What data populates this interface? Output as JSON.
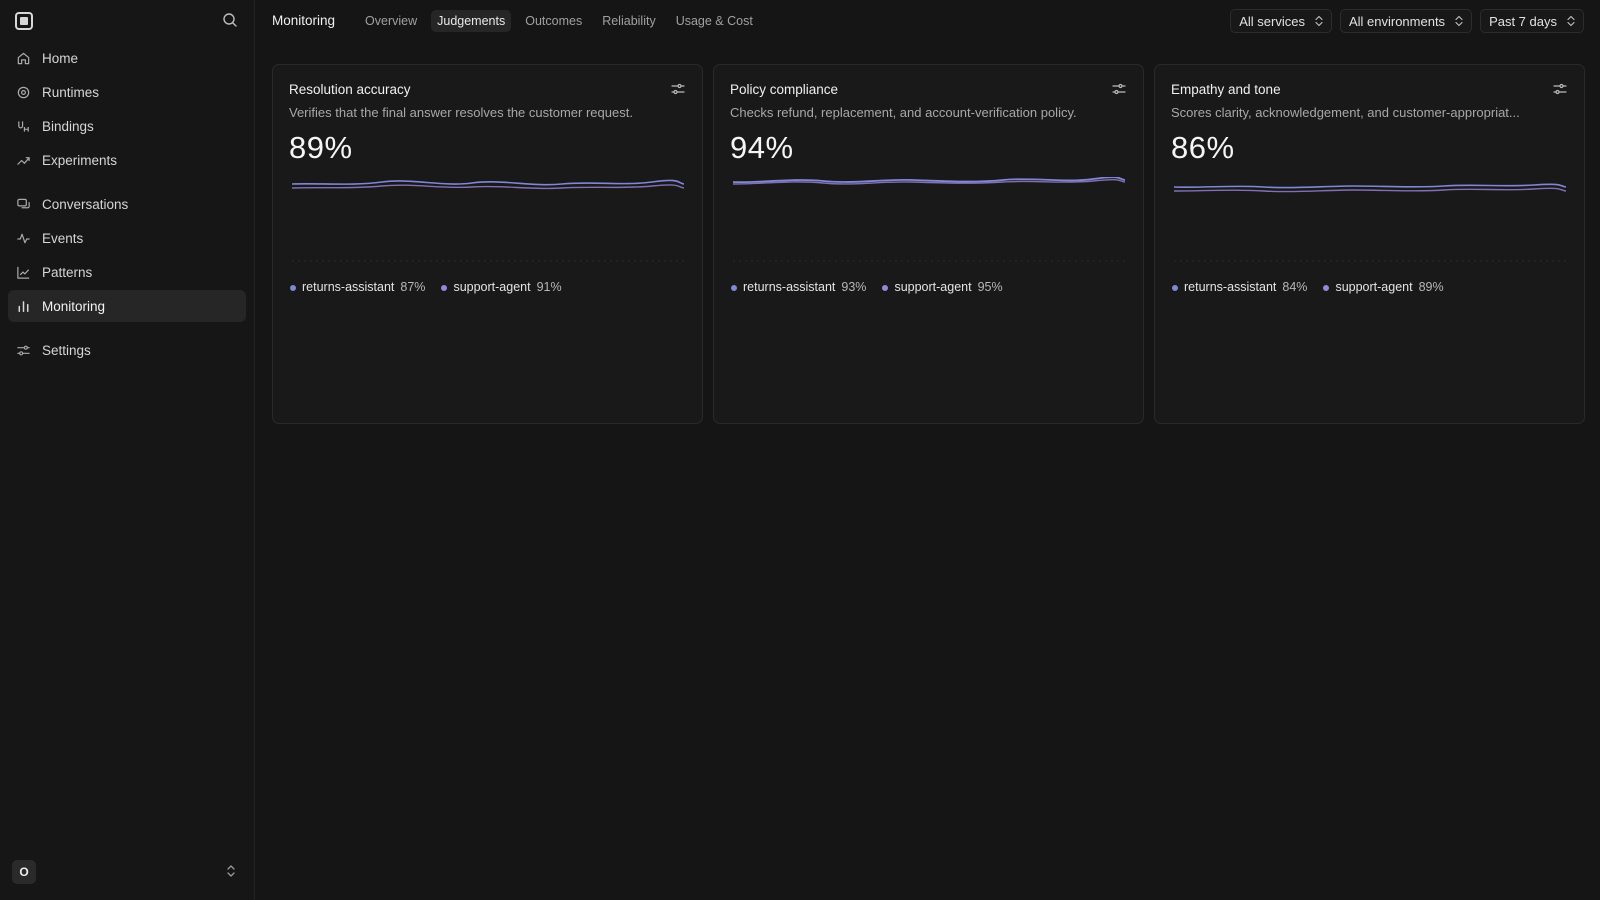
{
  "sidebar": {
    "items": [
      {
        "label": "Home",
        "icon": "home-icon"
      },
      {
        "label": "Runtimes",
        "icon": "runtime-icon"
      },
      {
        "label": "Bindings",
        "icon": "bindings-icon"
      },
      {
        "label": "Experiments",
        "icon": "experiments-icon"
      },
      {
        "label": "Conversations",
        "icon": "conversations-icon"
      },
      {
        "label": "Events",
        "icon": "events-icon"
      },
      {
        "label": "Patterns",
        "icon": "patterns-icon"
      },
      {
        "label": "Monitoring",
        "icon": "monitoring-icon",
        "active": true
      },
      {
        "label": "Settings",
        "icon": "settings-icon"
      }
    ],
    "workspace_initial": "O"
  },
  "topbar": {
    "title": "Monitoring",
    "tabs": [
      "Overview",
      "Judgements",
      "Outcomes",
      "Reliability",
      "Usage & Cost"
    ],
    "active_tab": "Judgements",
    "filters": [
      "All services",
      "All environments",
      "Past 7 days"
    ]
  },
  "colors": {
    "accent": "#7b7fd4",
    "series_returns": "#8087d6",
    "series_support": "#9a86d8"
  },
  "cards": [
    {
      "title": "Resolution accuracy",
      "description": "Verifies that the final answer resolves the customer request.",
      "value": "89%",
      "legend": [
        {
          "name": "returns-assistant",
          "value": "87%"
        },
        {
          "name": "support-agent",
          "value": "91%"
        }
      ]
    },
    {
      "title": "Policy compliance",
      "description": "Checks refund, replacement, and account-verification policy.",
      "value": "94%",
      "legend": [
        {
          "name": "returns-assistant",
          "value": "93%"
        },
        {
          "name": "support-agent",
          "value": "95%"
        }
      ]
    },
    {
      "title": "Empathy and tone",
      "description": "Scores clarity, acknowledgement, and customer-appropriat...",
      "value": "86%",
      "legend": [
        {
          "name": "returns-assistant",
          "value": "84%"
        },
        {
          "name": "support-agent",
          "value": "89%"
        }
      ]
    }
  ]
}
